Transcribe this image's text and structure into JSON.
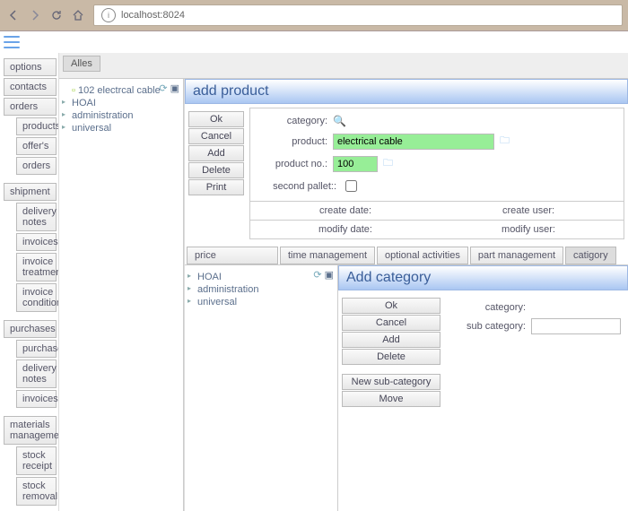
{
  "browser": {
    "url": "localhost:8024"
  },
  "sidebar": {
    "options": "options",
    "contacts": "contacts",
    "orders_head": "orders",
    "orders": [
      "products",
      "offer's",
      "orders"
    ],
    "shipment_head": "shipment",
    "shipment": [
      "delivery notes",
      "invoices",
      "invoice treatments",
      "invoice conditions"
    ],
    "purchases_head": "purchases",
    "purchases": [
      "purchases",
      "delivery notes",
      "invoices"
    ],
    "materials_head": "materials management",
    "materials": [
      "stock receipt",
      "stock removal"
    ]
  },
  "toolbar": {
    "alles": "Alles"
  },
  "tree1": {
    "n0": "102 electrcal cable",
    "n1": "HOAI",
    "n2": "administration",
    "n3": "universal"
  },
  "addProduct": {
    "title": "add product",
    "buttons": {
      "ok": "Ok",
      "cancel": "Cancel",
      "add": "Add",
      "delete": "Delete",
      "print": "Print"
    },
    "labels": {
      "category": "category:",
      "product": "product:",
      "productno": "product no.:",
      "secondPallet": "second pallet::"
    },
    "values": {
      "product": "electrical cable",
      "productno": "100"
    },
    "read": {
      "createDate": "create date:",
      "createUser": "create user:",
      "modifyDate": "modify date:",
      "modifyUser": "modify user:"
    }
  },
  "tabs": {
    "price": "price",
    "time": "time management",
    "opt": "optional activities",
    "part": "part management",
    "cat": "catigory"
  },
  "tree2": {
    "n0": "HOAI",
    "n1": "administration",
    "n2": "universal"
  },
  "addCategory": {
    "title": "Add category",
    "buttons": {
      "ok": "Ok",
      "cancel": "Cancel",
      "add": "Add",
      "delete": "Delete",
      "newsub": "New sub-category",
      "move": "Move"
    },
    "labels": {
      "category": "category:",
      "sub": "sub category:"
    }
  }
}
